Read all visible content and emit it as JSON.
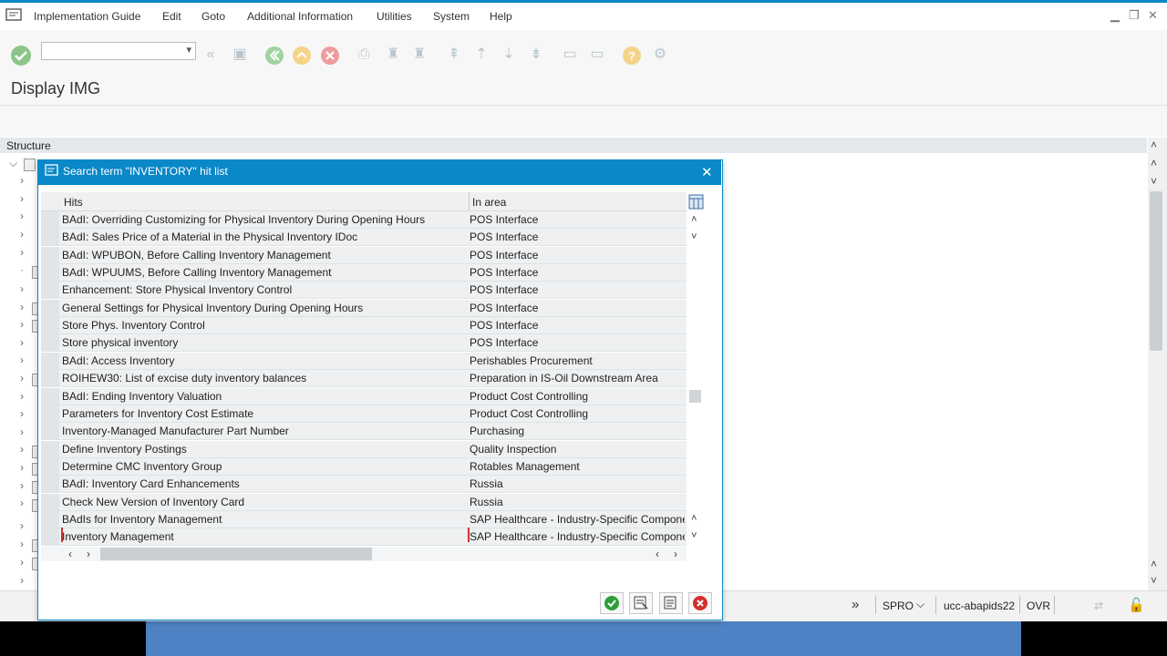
{
  "menu": {
    "items": [
      "Implementation Guide",
      "Edit",
      "Goto",
      "Additional Information",
      "Utilities",
      "System",
      "Help"
    ]
  },
  "toolbar": {
    "command_field_value": ""
  },
  "page": {
    "title": "Display IMG"
  },
  "structure": {
    "header": "Structure"
  },
  "dialog": {
    "title": "Search term \"INVENTORY\" hit list",
    "columns": [
      "Hits",
      "In area"
    ],
    "rows": [
      {
        "hit": "BAdI: Overriding Customizing for Physical Inventory During Opening Hours",
        "area": "POS Interface"
      },
      {
        "hit": "BAdI: Sales Price of a Material in the Physical Inventory IDoc",
        "area": "POS Interface"
      },
      {
        "hit": "BAdI: WPUBON, Before Calling Inventory Management",
        "area": "POS Interface"
      },
      {
        "hit": "BAdI: WPUUMS, Before Calling Inventory Management",
        "area": "POS Interface"
      },
      {
        "hit": "Enhancement: Store Physical Inventory Control",
        "area": "POS Interface"
      },
      {
        "hit": "General Settings for Physical Inventory During Opening Hours",
        "area": "POS Interface"
      },
      {
        "hit": "Store Phys. Inventory Control",
        "area": "POS Interface"
      },
      {
        "hit": "Store physical inventory",
        "area": "POS Interface"
      },
      {
        "hit": "BAdI: Access Inventory",
        "area": "Perishables Procurement"
      },
      {
        "hit": "ROIHEW30: List of excise duty inventory balances",
        "area": "Preparation in IS-Oil Downstream Area"
      },
      {
        "hit": "BAdI: Ending Inventory Valuation",
        "area": "Product Cost Controlling"
      },
      {
        "hit": "Parameters for Inventory Cost Estimate",
        "area": "Product Cost Controlling"
      },
      {
        "hit": "Inventory-Managed Manufacturer Part Number",
        "area": "Purchasing"
      },
      {
        "hit": "Define Inventory Postings",
        "area": "Quality Inspection"
      },
      {
        "hit": "Determine CMC Inventory Group",
        "area": "Rotables Management"
      },
      {
        "hit": "BAdI: Inventory Card Enhancements",
        "area": "Russia"
      },
      {
        "hit": "Check New Version of Inventory Card",
        "area": "Russia"
      },
      {
        "hit": "BAdIs for Inventory Management",
        "area": "SAP Healthcare - Industry-Specific Componer"
      },
      {
        "hit": "Inventory Management",
        "area": "SAP Healthcare - Industry-Specific Componer"
      }
    ]
  },
  "status": {
    "transaction": "SPRO",
    "server": "ucc-abapids22",
    "mode": "OVR"
  }
}
